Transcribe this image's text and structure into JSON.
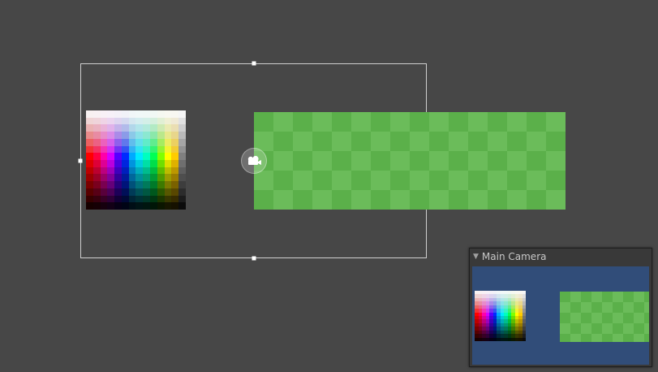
{
  "scene_view": {
    "background": "#474747",
    "selection_color": "#cfcfcf",
    "handles": [
      "top",
      "bottom",
      "left",
      "right"
    ]
  },
  "camera_gizmo": {
    "icon": "camera-icon"
  },
  "checker_colors": {
    "dark": "#5bb04a",
    "light": "#6bbc5a"
  },
  "camera_preview": {
    "title": "Main Camera",
    "foldout_icon": "triangle-down-icon",
    "background": "#314d79"
  }
}
